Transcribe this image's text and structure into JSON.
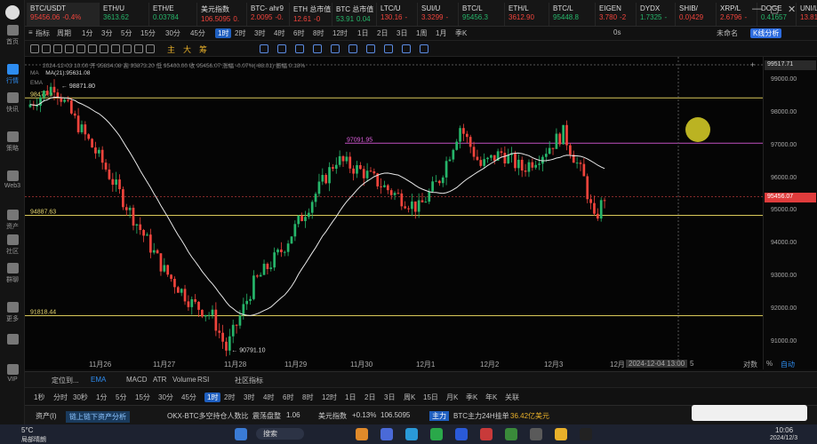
{
  "nav": [
    {
      "label": "首页",
      "icon": "home-icon"
    },
    {
      "label": "行情",
      "icon": "market-icon",
      "active": true
    },
    {
      "label": "快讯",
      "icon": "news-icon"
    },
    {
      "label": "策略",
      "icon": "strategy-icon"
    },
    {
      "label": "Web3",
      "icon": "web3-icon"
    },
    {
      "label": "资产",
      "icon": "wallet-icon"
    },
    {
      "label": "社区",
      "icon": "community-icon"
    },
    {
      "label": "群聊",
      "icon": "chat-icon"
    },
    {
      "label": "更多",
      "icon": "more-icon"
    },
    {
      "label": "",
      "icon": "phone-icon"
    },
    {
      "label": "VIP",
      "icon": "vip-icon"
    }
  ],
  "tabs": [
    {
      "name": "BTC/USDT",
      "price": "95456.06",
      "change": "-0.4%",
      "dir": "dn",
      "active": true
    },
    {
      "name": "ETH/U",
      "price": "3613.62",
      "change": "",
      "dir": "up"
    },
    {
      "name": "ETH/E",
      "price": "0.03784",
      "change": "",
      "dir": "up"
    },
    {
      "name": "美元指数",
      "price": "106.5095",
      "change": "0.",
      "dir": "dn"
    },
    {
      "name": "BTC- ahr9",
      "price": "2.0095",
      "change": "-0.",
      "dir": "dn"
    },
    {
      "name": "ETH 总市值",
      "price": "12.61",
      "change": "-0",
      "dir": "dn"
    },
    {
      "name": "BTC 总市值",
      "price": "53.91",
      "change": "0.04",
      "dir": "up"
    },
    {
      "name": "LTC/U",
      "price": "130.16",
      "change": "-",
      "dir": "dn"
    },
    {
      "name": "SUI/U",
      "price": "3.3299",
      "change": "-",
      "dir": "dn"
    },
    {
      "name": "BTC/L",
      "price": "95456.3",
      "change": "",
      "dir": "up"
    },
    {
      "name": "ETH/L",
      "price": "3612.90",
      "change": "",
      "dir": "dn"
    },
    {
      "name": "BTC/L",
      "price": "95448.8",
      "change": "",
      "dir": "up"
    },
    {
      "name": "EIGEN",
      "price": "3.780",
      "change": "-2",
      "dir": "dn"
    },
    {
      "name": "DYDX",
      "price": "1.7325",
      "change": "-",
      "dir": "up"
    },
    {
      "name": "SHIB/",
      "price": "0.0)429",
      "change": "",
      "dir": "dn"
    },
    {
      "name": "XRP/L",
      "price": "2.6796",
      "change": "-",
      "dir": "dn"
    },
    {
      "name": "DOGE",
      "price": "0.41657",
      "change": "",
      "dir": "up"
    },
    {
      "name": "UNI/L",
      "price": "13.817",
      "change": "-",
      "dir": "dn"
    }
  ],
  "window_controls": {
    "min": "—",
    "max": "▢",
    "close": "✕"
  },
  "toolbar": {
    "items": [
      "指标",
      "周期",
      "1分",
      "3分",
      "5分",
      "15分",
      "30分",
      "45分",
      "1时",
      "2时",
      "3时",
      "4时",
      "6时",
      "8时",
      "12时",
      "1日",
      "2日",
      "3日",
      "1周",
      "1月",
      "季K"
    ],
    "active_interval": "1时",
    "indicator_label": "指标",
    "period_label": "周期",
    "right_items": [
      "0s"
    ],
    "account": "未命名",
    "kline_analysis": "K线分析"
  },
  "draw": {
    "labels": [
      "主",
      "大",
      "筹"
    ]
  },
  "price_scale": {
    "ticks": [
      "99000.00",
      "98000.00",
      "97000.00",
      "96000.00",
      "95000.00",
      "94000.00",
      "93000.00",
      "92000.00",
      "91000.00"
    ],
    "current": "95456.07",
    "top_label": "99517.71"
  },
  "info_line": "2024-12-03 10:00  开 95834.08  高 95873.20  低 95400.00  收 95456.07  涨幅 -0.07%(-68.01)  振幅 0.18%",
  "ma_label": "MA",
  "ma_value": "MA(21):95631.08",
  "ema_label": "EMA",
  "annotations": {
    "high": "98871.80",
    "low": "90791.10",
    "lines": [
      "98477.9",
      "97091.95",
      "94887.63",
      "91818.44"
    ]
  },
  "xaxis": [
    "11月26",
    "11月27",
    "11月28",
    "11月29",
    "11月30",
    "12月1",
    "12月2",
    "12月3",
    "12月",
    "2024-12-04 13:00",
    "5"
  ],
  "bottom_right": {
    "log": "对数",
    "pct": "%",
    "auto": "自动"
  },
  "subtabs": [
    "定位到...",
    "EMA",
    "MACD",
    "ATR",
    "Volume",
    "RSI",
    "社区指标"
  ],
  "timebar": [
    "1秒",
    "分时",
    "30秒",
    "1分",
    "5分",
    "15分",
    "30分",
    "45分",
    "1时",
    "2时",
    "3时",
    "4时",
    "6时",
    "8时",
    "12时",
    "1日",
    "2日",
    "3日",
    "周K",
    "15日",
    "月K",
    "季K",
    "年K",
    "关联"
  ],
  "timebar_active": "1时",
  "ticker": {
    "asset": "资产(I)",
    "link": "链上链下资产分析",
    "news": "OKX-BTC多空持仓人数比",
    "news2": "震荡盘整",
    "v1": "1.06",
    "usd": "美元指数",
    "usd_ch": "+0.13%",
    "usd_v": "106.5095",
    "main": "主力",
    "btc": "BTC主力24H挂单",
    "btc_v": "36.42亿美元"
  },
  "taskbar": {
    "weather": "5°C",
    "weather2": "局部晴朗",
    "search": "搜索",
    "time": "10:06",
    "date": "2024/12/3"
  },
  "chart_data": {
    "type": "candlestick",
    "symbol": "BTC/USDT",
    "interval": "1h",
    "ylim": [
      90500,
      99517.71
    ],
    "current_price": 95456.07,
    "high_label": 98871.8,
    "low_label": 90791.1,
    "horizontal_lines": [
      98477.9,
      97091.95,
      94887.63,
      91818.44
    ],
    "ma21_last": 95631.08
  }
}
